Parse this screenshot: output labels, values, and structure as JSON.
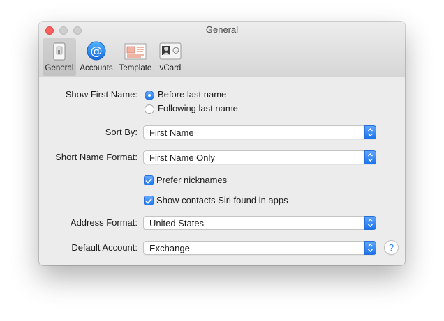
{
  "window": {
    "title": "General"
  },
  "toolbar": {
    "items": [
      {
        "label": "General",
        "icon": "general-icon",
        "selected": true
      },
      {
        "label": "Accounts",
        "icon": "at-sign-icon",
        "selected": false
      },
      {
        "label": "Template",
        "icon": "template-icon",
        "selected": false
      },
      {
        "label": "vCard",
        "icon": "vcard-icon",
        "selected": false
      }
    ]
  },
  "form": {
    "show_first_name": {
      "label": "Show First Name:",
      "options": [
        "Before last name",
        "Following last name"
      ],
      "selected_index": 0
    },
    "sort_by": {
      "label": "Sort By:",
      "value": "First Name"
    },
    "short_name_format": {
      "label": "Short Name Format:",
      "value": "First Name Only"
    },
    "prefer_nicknames": {
      "label": "Prefer nicknames",
      "checked": true
    },
    "show_siri_contacts": {
      "label": "Show contacts Siri found in apps",
      "checked": true
    },
    "address_format": {
      "label": "Address Format:",
      "value": "United States"
    },
    "default_account": {
      "label": "Default Account:",
      "value": "Exchange"
    }
  },
  "help": {
    "glyph": "?"
  },
  "colors": {
    "accent": "#1b7bf1",
    "close_button": "#fc605c",
    "window_background": "#ececec"
  }
}
